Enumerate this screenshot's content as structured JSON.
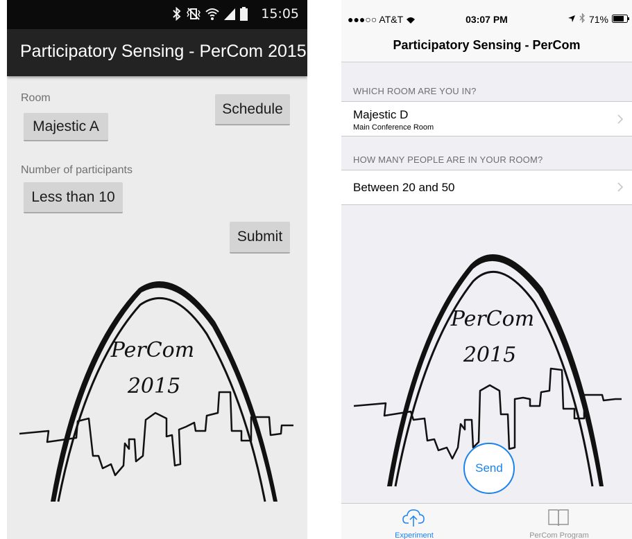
{
  "android": {
    "status_time": "15:05",
    "app_title": "Participatory Sensing - PerCom 2015",
    "room_label": "Room",
    "room_value": "Majestic A",
    "schedule_button": "Schedule",
    "participants_label": "Number of participants",
    "participants_value": "Less than 10",
    "submit_button": "Submit",
    "logo_text": [
      "PerCom",
      "2015"
    ]
  },
  "ios": {
    "carrier": "●●●○○ AT&T",
    "time": "03:07 PM",
    "battery": "71%",
    "nav_title": "Participatory Sensing - PerCom",
    "room_section_header": "WHICH ROOM ARE YOU IN?",
    "room_value": "Majestic D",
    "room_subtitle": "Main Conference Room",
    "people_section_header": "HOW MANY PEOPLE ARE IN YOUR ROOM?",
    "people_value": "Between 20 and 50",
    "send_button": "Send",
    "logo_text": [
      "PerCom",
      "2015"
    ],
    "tabs": [
      {
        "label": "Experiment",
        "icon": "cloud-upload-icon",
        "selected": true
      },
      {
        "label": "PerCom Program",
        "icon": "book-icon",
        "selected": false
      }
    ],
    "accent_color": "#1a82ef"
  }
}
